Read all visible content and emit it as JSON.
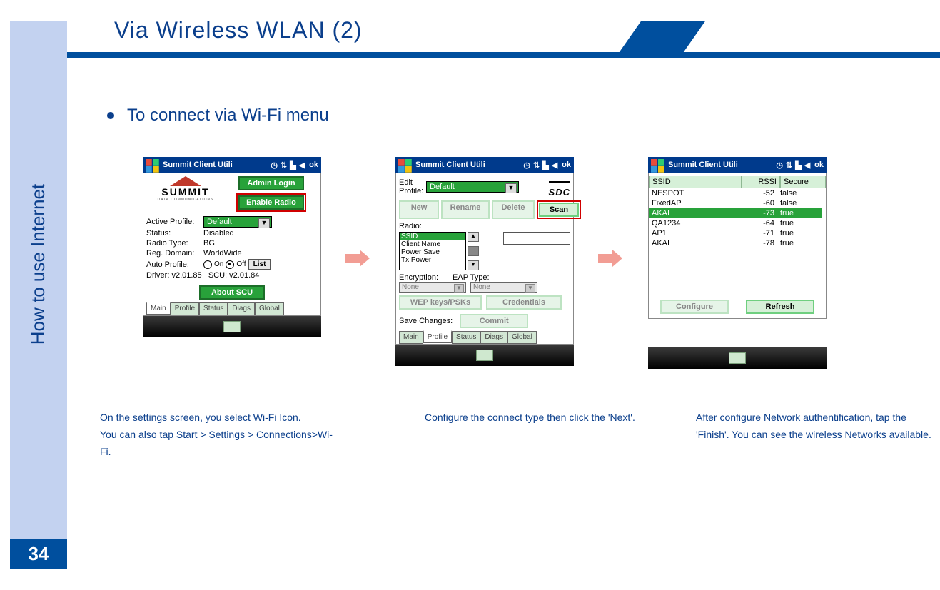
{
  "page_number": "34",
  "side_title": "How to use Internet",
  "title": "Via Wireless WLAN (2)",
  "bullet": "To connect via Wi-Fi menu",
  "captions": {
    "c1": "On the settings screen, you select Wi-Fi Icon.\nYou can also tap Start > Settings > Connections>Wi-Fi.",
    "c2": "Configure the connect type then click the 'Next'.",
    "c3": "After configure Network authentification, tap the 'Finish'. You can see the wireless Networks available."
  },
  "phone_title": "Summit Client Utili",
  "ok_label": "ok",
  "tabs": {
    "main": "Main",
    "profile": "Profile",
    "status": "Status",
    "diags": "Diags",
    "global": "Global"
  },
  "s1": {
    "logo_word": "SUMMIT",
    "logo_sub": "DATA COMMUNICATIONS",
    "admin_login": "Admin Login",
    "enable_radio": "Enable Radio",
    "active_profile_label": "Active Profile:",
    "active_profile_value": "Default",
    "status_label": "Status:",
    "status_value": "Disabled",
    "radio_type_label": "Radio Type:",
    "radio_type_value": "BG",
    "reg_domain_label": "Reg. Domain:",
    "reg_domain_value": "WorldWide",
    "auto_profile_label": "Auto Profile:",
    "on": "On",
    "off": "Off",
    "list": "List",
    "driver_label": "Driver:",
    "driver_value": "v2.01.85",
    "scu_label": "SCU:",
    "scu_value": "v2.01.84",
    "about": "About SCU"
  },
  "s2": {
    "edit_profile_label": "Edit\nProfile:",
    "profile_value": "Default",
    "sdc": "SDC",
    "new": "New",
    "rename": "Rename",
    "delete": "Delete",
    "scan": "Scan",
    "radio_label": "Radio:",
    "list": {
      "ssid": "SSID",
      "client": "Client Name",
      "power": "Power Save",
      "tx": "Tx Power"
    },
    "encryption_label": "Encryption:",
    "eap_label": "EAP Type:",
    "none": "None",
    "wep": "WEP keys/PSKs",
    "cred": "Credentials",
    "save_label": "Save Changes:",
    "commit": "Commit"
  },
  "s3": {
    "hdr": {
      "ssid": "SSID",
      "rssi": "RSSI",
      "secure": "Secure"
    },
    "rows": [
      {
        "ssid": "NESPOT",
        "rssi": "-52",
        "secure": "false"
      },
      {
        "ssid": "FixedAP",
        "rssi": "-60",
        "secure": "false"
      },
      {
        "ssid": "AKAI",
        "rssi": "-73",
        "secure": "true",
        "hi": true
      },
      {
        "ssid": "QA1234",
        "rssi": "-64",
        "secure": "true"
      },
      {
        "ssid": "AP1",
        "rssi": "-71",
        "secure": "true"
      },
      {
        "ssid": "AKAI",
        "rssi": "-78",
        "secure": "true"
      }
    ],
    "configure": "Configure",
    "refresh": "Refresh"
  }
}
